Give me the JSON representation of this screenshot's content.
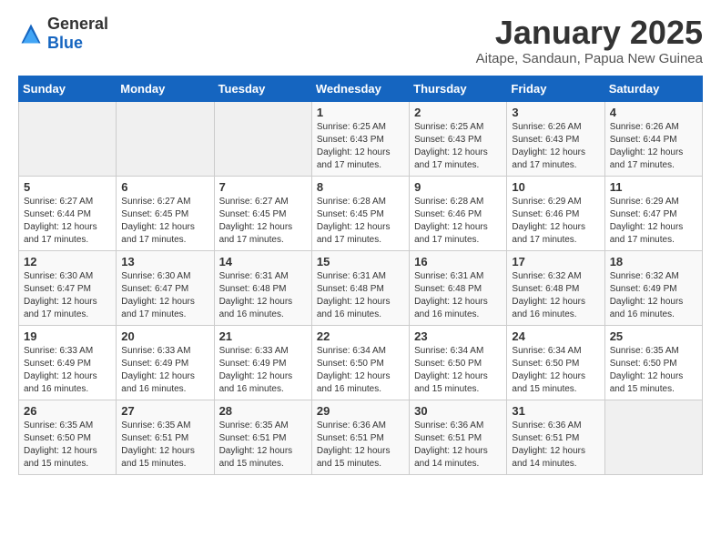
{
  "logo": {
    "general": "General",
    "blue": "Blue"
  },
  "header": {
    "month": "January 2025",
    "location": "Aitape, Sandaun, Papua New Guinea"
  },
  "weekdays": [
    "Sunday",
    "Monday",
    "Tuesday",
    "Wednesday",
    "Thursday",
    "Friday",
    "Saturday"
  ],
  "weeks": [
    [
      {
        "day": "",
        "info": ""
      },
      {
        "day": "",
        "info": ""
      },
      {
        "day": "",
        "info": ""
      },
      {
        "day": "1",
        "info": "Sunrise: 6:25 AM\nSunset: 6:43 PM\nDaylight: 12 hours and 17 minutes."
      },
      {
        "day": "2",
        "info": "Sunrise: 6:25 AM\nSunset: 6:43 PM\nDaylight: 12 hours and 17 minutes."
      },
      {
        "day": "3",
        "info": "Sunrise: 6:26 AM\nSunset: 6:43 PM\nDaylight: 12 hours and 17 minutes."
      },
      {
        "day": "4",
        "info": "Sunrise: 6:26 AM\nSunset: 6:44 PM\nDaylight: 12 hours and 17 minutes."
      }
    ],
    [
      {
        "day": "5",
        "info": "Sunrise: 6:27 AM\nSunset: 6:44 PM\nDaylight: 12 hours and 17 minutes."
      },
      {
        "day": "6",
        "info": "Sunrise: 6:27 AM\nSunset: 6:45 PM\nDaylight: 12 hours and 17 minutes."
      },
      {
        "day": "7",
        "info": "Sunrise: 6:27 AM\nSunset: 6:45 PM\nDaylight: 12 hours and 17 minutes."
      },
      {
        "day": "8",
        "info": "Sunrise: 6:28 AM\nSunset: 6:45 PM\nDaylight: 12 hours and 17 minutes."
      },
      {
        "day": "9",
        "info": "Sunrise: 6:28 AM\nSunset: 6:46 PM\nDaylight: 12 hours and 17 minutes."
      },
      {
        "day": "10",
        "info": "Sunrise: 6:29 AM\nSunset: 6:46 PM\nDaylight: 12 hours and 17 minutes."
      },
      {
        "day": "11",
        "info": "Sunrise: 6:29 AM\nSunset: 6:47 PM\nDaylight: 12 hours and 17 minutes."
      }
    ],
    [
      {
        "day": "12",
        "info": "Sunrise: 6:30 AM\nSunset: 6:47 PM\nDaylight: 12 hours and 17 minutes."
      },
      {
        "day": "13",
        "info": "Sunrise: 6:30 AM\nSunset: 6:47 PM\nDaylight: 12 hours and 17 minutes."
      },
      {
        "day": "14",
        "info": "Sunrise: 6:31 AM\nSunset: 6:48 PM\nDaylight: 12 hours and 16 minutes."
      },
      {
        "day": "15",
        "info": "Sunrise: 6:31 AM\nSunset: 6:48 PM\nDaylight: 12 hours and 16 minutes."
      },
      {
        "day": "16",
        "info": "Sunrise: 6:31 AM\nSunset: 6:48 PM\nDaylight: 12 hours and 16 minutes."
      },
      {
        "day": "17",
        "info": "Sunrise: 6:32 AM\nSunset: 6:48 PM\nDaylight: 12 hours and 16 minutes."
      },
      {
        "day": "18",
        "info": "Sunrise: 6:32 AM\nSunset: 6:49 PM\nDaylight: 12 hours and 16 minutes."
      }
    ],
    [
      {
        "day": "19",
        "info": "Sunrise: 6:33 AM\nSunset: 6:49 PM\nDaylight: 12 hours and 16 minutes."
      },
      {
        "day": "20",
        "info": "Sunrise: 6:33 AM\nSunset: 6:49 PM\nDaylight: 12 hours and 16 minutes."
      },
      {
        "day": "21",
        "info": "Sunrise: 6:33 AM\nSunset: 6:49 PM\nDaylight: 12 hours and 16 minutes."
      },
      {
        "day": "22",
        "info": "Sunrise: 6:34 AM\nSunset: 6:50 PM\nDaylight: 12 hours and 16 minutes."
      },
      {
        "day": "23",
        "info": "Sunrise: 6:34 AM\nSunset: 6:50 PM\nDaylight: 12 hours and 15 minutes."
      },
      {
        "day": "24",
        "info": "Sunrise: 6:34 AM\nSunset: 6:50 PM\nDaylight: 12 hours and 15 minutes."
      },
      {
        "day": "25",
        "info": "Sunrise: 6:35 AM\nSunset: 6:50 PM\nDaylight: 12 hours and 15 minutes."
      }
    ],
    [
      {
        "day": "26",
        "info": "Sunrise: 6:35 AM\nSunset: 6:50 PM\nDaylight: 12 hours and 15 minutes."
      },
      {
        "day": "27",
        "info": "Sunrise: 6:35 AM\nSunset: 6:51 PM\nDaylight: 12 hours and 15 minutes."
      },
      {
        "day": "28",
        "info": "Sunrise: 6:35 AM\nSunset: 6:51 PM\nDaylight: 12 hours and 15 minutes."
      },
      {
        "day": "29",
        "info": "Sunrise: 6:36 AM\nSunset: 6:51 PM\nDaylight: 12 hours and 15 minutes."
      },
      {
        "day": "30",
        "info": "Sunrise: 6:36 AM\nSunset: 6:51 PM\nDaylight: 12 hours and 14 minutes."
      },
      {
        "day": "31",
        "info": "Sunrise: 6:36 AM\nSunset: 6:51 PM\nDaylight: 12 hours and 14 minutes."
      },
      {
        "day": "",
        "info": ""
      }
    ]
  ]
}
